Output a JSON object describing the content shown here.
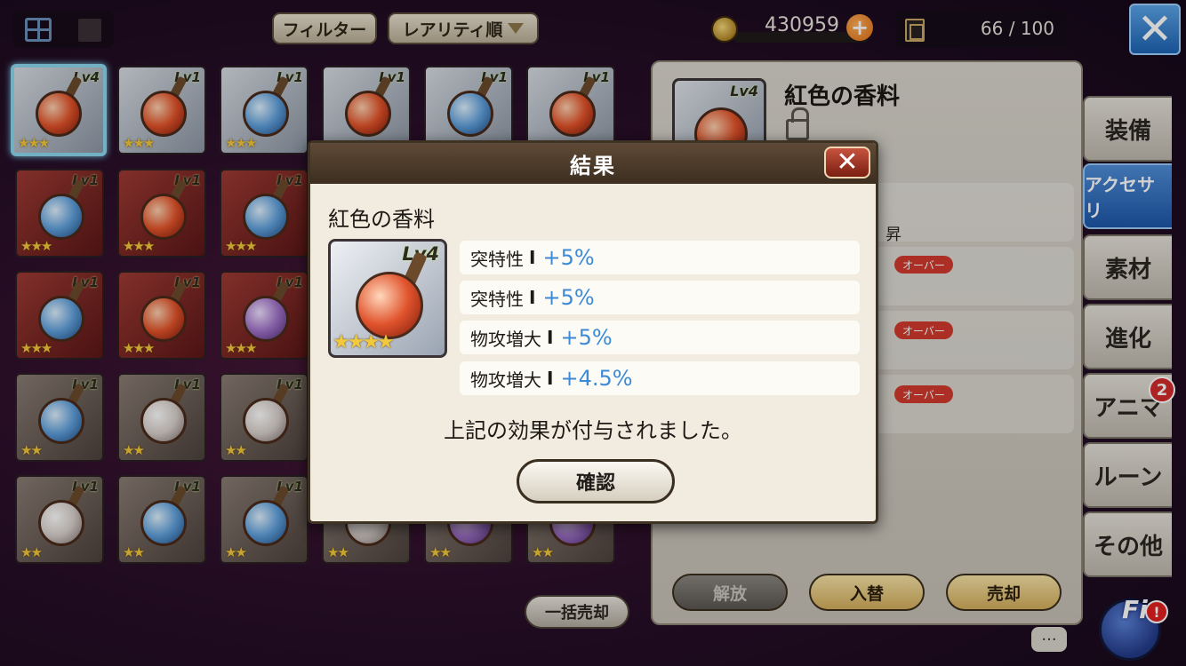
{
  "top_bar": {
    "filter_label": "フィルター",
    "sort_label": "レアリティ順",
    "gold": "430959",
    "capacity": "66 / 100"
  },
  "inventory": {
    "lv4": "Lv4",
    "lv1": "Lv1",
    "stars4": "★★★★",
    "stars3": "★★★",
    "stars2": "★★"
  },
  "detail": {
    "item_name": "紅色の香料",
    "stat_partial": "昇",
    "over_label": "オーバー",
    "buttons": {
      "release": "解放",
      "swap": "入替",
      "sell": "売却"
    }
  },
  "side_tabs": [
    "装備",
    "アクセサリ",
    "素材",
    "進化",
    "アニマ",
    "ルーン",
    "その他"
  ],
  "anima_badge": "2",
  "bulk_sell": "一括売却",
  "mascot_label": "Fi",
  "mascot_alert": "!",
  "chat_icon_text": "···",
  "modal": {
    "title": "結果",
    "item_name": "紅色の香料",
    "item_level": "Lv4",
    "item_stars": "★★★★",
    "effects": [
      {
        "name": "突特性",
        "sep": "I",
        "value": "+5%"
      },
      {
        "name": "突特性",
        "sep": "I",
        "value": "+5%"
      },
      {
        "name": "物攻増大",
        "sep": "I",
        "value": "+5%"
      },
      {
        "name": "物攻増大",
        "sep": "I",
        "value": "+4.5%"
      }
    ],
    "message": "上記の効果が付与されました。",
    "confirm_label": "確認"
  }
}
